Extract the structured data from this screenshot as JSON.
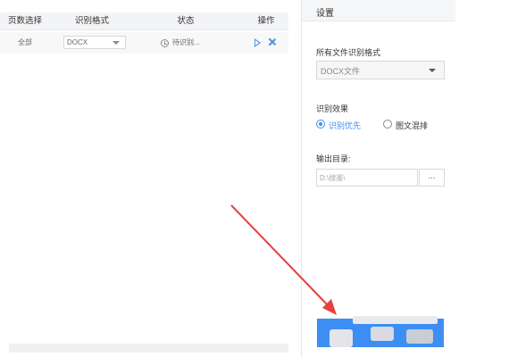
{
  "table": {
    "columns": [
      "页数选择",
      "识别格式",
      "状态",
      "操作"
    ],
    "rows": [
      {
        "pages": "全部",
        "format": "DOCX",
        "status": "待识别..."
      }
    ]
  },
  "settings": {
    "title": "设置",
    "format_label": "所有文件识别格式",
    "format_value": "DOCX文件",
    "effect_label": "识别效果",
    "effect_options": [
      "识别优先",
      "图文混排"
    ],
    "effect_selected": "识别优先",
    "output_label": "输出目录:",
    "output_value": "D:\\搜墨\\",
    "browse_label": "..."
  },
  "colors": {
    "accent": "#3d8ef2",
    "arrow": "#e8403a"
  },
  "icons": [
    "clock-icon",
    "play-icon",
    "close-icon",
    "chevron-down-icon"
  ]
}
